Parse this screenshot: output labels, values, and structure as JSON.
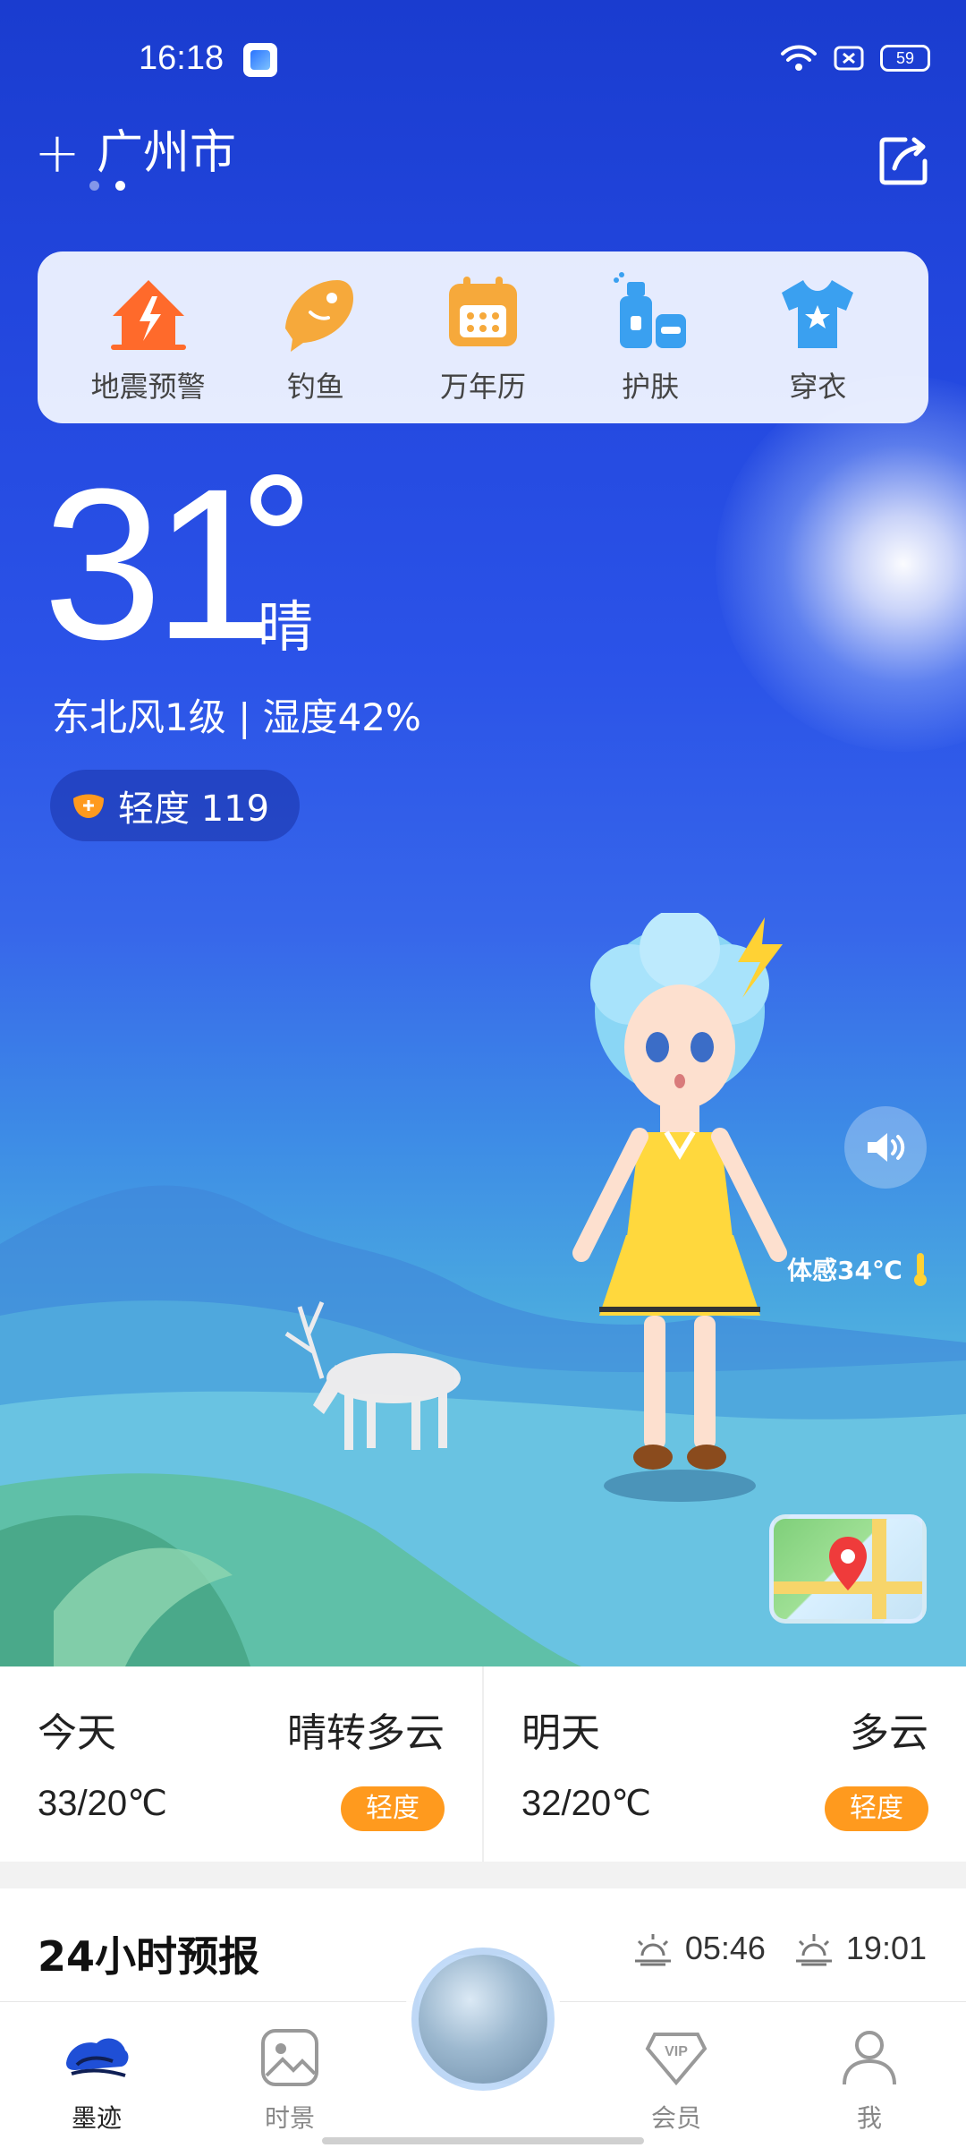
{
  "status_bar": {
    "time": "16:18",
    "battery": "59"
  },
  "header": {
    "add_symbol": "+",
    "city": "广州市"
  },
  "tools": [
    {
      "label": "地震预警",
      "icon": "earthquake-alert-icon"
    },
    {
      "label": "钓鱼",
      "icon": "fish-icon"
    },
    {
      "label": "万年历",
      "icon": "calendar-icon"
    },
    {
      "label": "护肤",
      "icon": "skincare-icon"
    },
    {
      "label": "穿衣",
      "icon": "tshirt-icon"
    }
  ],
  "current": {
    "temperature": "31",
    "condition": "晴",
    "wind_humidity": "东北风1级 | 湿度42%",
    "aqi_text": "轻度 119",
    "feels_like": "体感34℃"
  },
  "forecast": [
    {
      "day": "今天",
      "condition": "晴转多云",
      "temp": "33/20℃",
      "aqi": "轻度"
    },
    {
      "day": "明天",
      "condition": "多云",
      "temp": "32/20℃",
      "aqi": "轻度"
    }
  ],
  "hourly": {
    "title": "24小时预报",
    "sunrise": "05:46",
    "sunset": "19:01"
  },
  "nav": [
    {
      "label": "墨迹",
      "icon": "moji-logo-icon",
      "active": true
    },
    {
      "label": "时景",
      "icon": "gallery-icon",
      "active": false
    },
    {
      "label": "会员",
      "icon": "vip-icon",
      "active": false
    },
    {
      "label": "我",
      "icon": "profile-icon",
      "active": false
    }
  ],
  "colors": {
    "accent_orange": "#ff9a1e",
    "sky_blue": "#2246dd"
  }
}
